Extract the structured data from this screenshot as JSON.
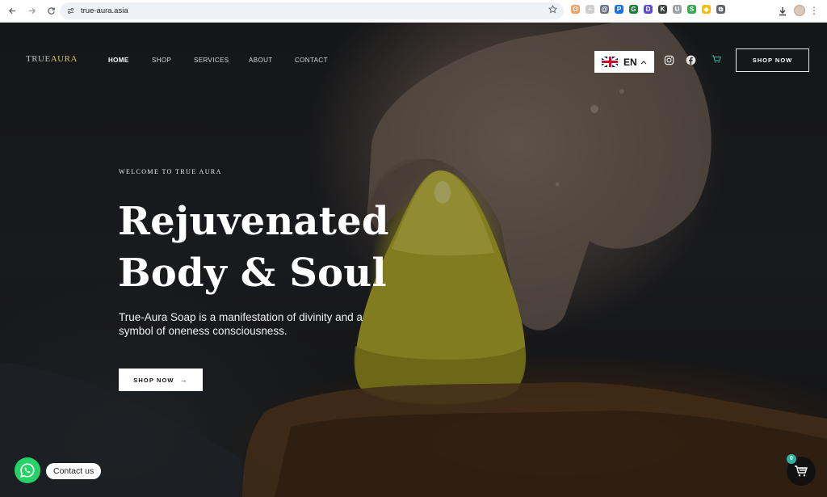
{
  "browser": {
    "url": "true-aura.asia",
    "back_icon": "arrow-left-icon",
    "forward_icon": "arrow-right-icon",
    "reload_icon": "reload-icon",
    "bookmark_icon": "star-icon",
    "downloads_icon": "download-icon",
    "menu_icon": "kebab-icon",
    "extensions": [
      {
        "name": "ext-1",
        "color": "#f4a261",
        "glyph": "O"
      },
      {
        "name": "ext-2",
        "color": "#cfcfcf",
        "glyph": "+"
      },
      {
        "name": "ext-3",
        "color": "#6b7280",
        "glyph": "@"
      },
      {
        "name": "ext-4",
        "color": "#1a73e8",
        "glyph": "P"
      },
      {
        "name": "ext-5",
        "color": "#188038",
        "glyph": "G"
      },
      {
        "name": "ext-6",
        "color": "#5b4bd6",
        "glyph": "D"
      },
      {
        "name": "ext-7",
        "color": "#3c4043",
        "glyph": "K"
      },
      {
        "name": "ext-8",
        "color": "#9aa0a6",
        "glyph": "U"
      },
      {
        "name": "ext-9",
        "color": "#34a853",
        "glyph": "S"
      },
      {
        "name": "ext-10",
        "color": "#fbbc04",
        "glyph": "◆"
      },
      {
        "name": "puzzle",
        "color": "#5f6368",
        "glyph": "⧉"
      }
    ]
  },
  "site": {
    "logo_part1": "TRUE",
    "logo_part2": "AURA",
    "nav": [
      {
        "label": "HOME",
        "active": true
      },
      {
        "label": "SHOP",
        "active": false
      },
      {
        "label": "SERVICES",
        "active": false
      },
      {
        "label": "ABOUT",
        "active": false
      },
      {
        "label": "CONTACT",
        "active": false
      }
    ],
    "language": "EN",
    "header_cta": "SHOP NOW",
    "social": [
      "instagram-icon",
      "facebook-icon"
    ]
  },
  "hero": {
    "eyebrow": "WELCOME TO TRUE AURA",
    "headline_line1": "Rejuvenated",
    "headline_line2": "Body & Soul",
    "subtitle": "True-Aura Soap is a manifestation of divinity and a symbol of oneness consciousness.",
    "cta": "SHOP NOW",
    "cta_arrow": "→"
  },
  "widgets": {
    "contact_label": "Contact us",
    "cart_count": "0"
  },
  "colors": {
    "logo_accent": "#d8c24a",
    "whatsapp": "#25d366",
    "cart_badge": "#2bb5a0"
  }
}
